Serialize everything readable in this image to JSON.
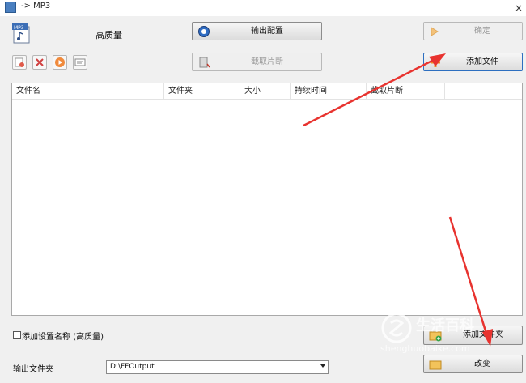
{
  "window": {
    "title": "-> MP3",
    "close_glyph": "×"
  },
  "format": {
    "icon": "mp3-file-icon",
    "icon_text": "MP3",
    "quality_label": "高质量"
  },
  "buttons": {
    "output_config": "输出配置",
    "confirm": "确定",
    "clip": "截取片断",
    "add_file": "添加文件",
    "add_folder": "添加文件夹",
    "change": "改变"
  },
  "list": {
    "columns": [
      "文件名",
      "文件夹",
      "大小",
      "持续时间",
      "截取片断"
    ],
    "rows": []
  },
  "footer": {
    "add_setting_checkbox": {
      "label": "添加设置名称 (高质量)",
      "checked": false
    },
    "output_folder_label": "输出文件夹",
    "output_folder_value": "D:\\FFOutput"
  },
  "watermark": {
    "line1": "生活百科",
    "line2": "shenghuobaike.com"
  },
  "colors": {
    "annotation_arrow": "#e8332f",
    "add_file_button_border": "#2d6fc0",
    "window_bg": "#f0f0f0"
  }
}
